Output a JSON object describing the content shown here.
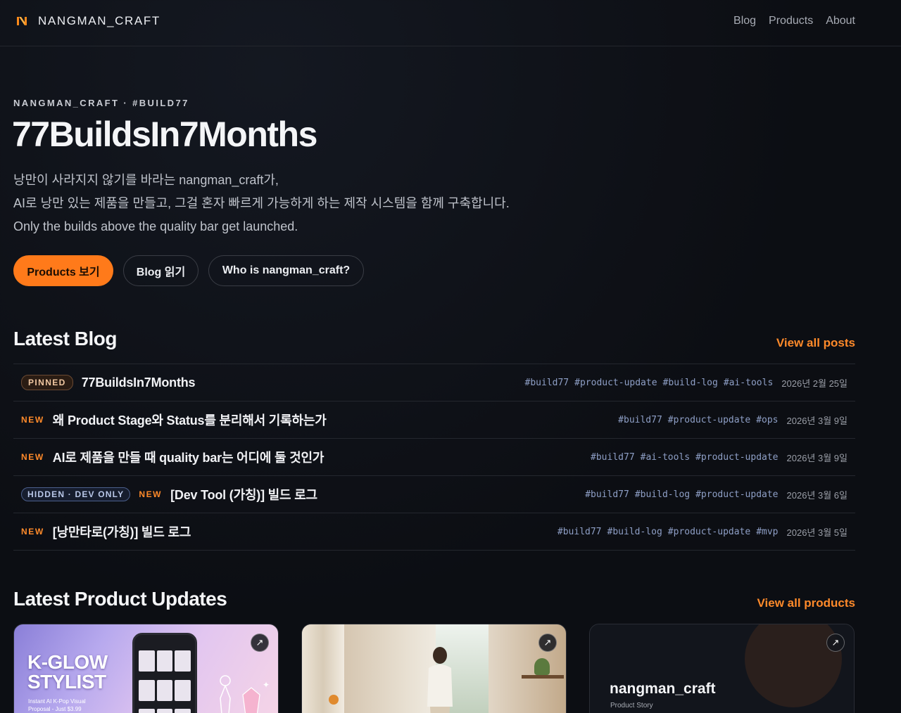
{
  "header": {
    "brand": "NANGMAN_CRAFT",
    "nav": [
      "Blog",
      "Products",
      "About"
    ]
  },
  "hero": {
    "eyebrow": "NANGMAN_CRAFT · #BUILD77",
    "title": "77BuildsIn7Months",
    "desc": [
      "낭만이 사라지지 않기를 바라는 nangman_craft가,",
      "AI로 낭만 있는 제품을 만들고, 그걸 혼자 빠르게 가능하게 하는 제작 시스템을 함께 구축합니다.",
      "Only the builds above the quality bar get launched."
    ],
    "buttons": {
      "primary": "Products 보기",
      "blog": "Blog 읽기",
      "who": "Who is nangman_craft?"
    }
  },
  "blog": {
    "title": "Latest Blog",
    "view_all": "View all posts",
    "rows": [
      {
        "badges": [
          "PINNED"
        ],
        "title": "77BuildsIn7Months",
        "tags": [
          "#build77",
          "#product-update",
          "#build-log",
          "#ai-tools"
        ],
        "date": "2026년 2월 25일"
      },
      {
        "badges": [
          "NEW"
        ],
        "title": "왜 Product Stage와 Status를 분리해서 기록하는가",
        "tags": [
          "#build77",
          "#product-update",
          "#ops"
        ],
        "date": "2026년 3월 9일"
      },
      {
        "badges": [
          "NEW"
        ],
        "title": "AI로 제품을 만들 때 quality bar는 어디에 둘 것인가",
        "tags": [
          "#build77",
          "#ai-tools",
          "#product-update"
        ],
        "date": "2026년 3월 9일"
      },
      {
        "badges": [
          "HIDDEN · DEV ONLY",
          "NEW"
        ],
        "title": "[Dev Tool (가칭)] 빌드 로그",
        "tags": [
          "#build77",
          "#build-log",
          "#product-update"
        ],
        "date": "2026년 3월 6일"
      },
      {
        "badges": [
          "NEW"
        ],
        "title": "[낭만타로(가칭)] 빌드 로그",
        "tags": [
          "#build77",
          "#build-log",
          "#product-update",
          "#mvp"
        ],
        "date": "2026년 3월 5일"
      }
    ]
  },
  "products": {
    "title": "Latest Product Updates",
    "view_all": "View all products",
    "cards": [
      {
        "name": "K-GLOW STYLIST",
        "line1": "K-GLOW",
        "line2": "STYLIST",
        "sub1": "Instant AI K-Pop Visual",
        "sub2": "Proposal - Just $3.99",
        "arrow": "↗"
      },
      {
        "name": "window-scene",
        "arrow": "↗"
      },
      {
        "name": "nangman_craft",
        "title": "nangman_craft",
        "sub": "Product Story",
        "arrow": "↗"
      }
    ]
  },
  "colors": {
    "accent": "#ff7a1a",
    "background": "#0c0e13",
    "tag": "#8e9fc6"
  }
}
